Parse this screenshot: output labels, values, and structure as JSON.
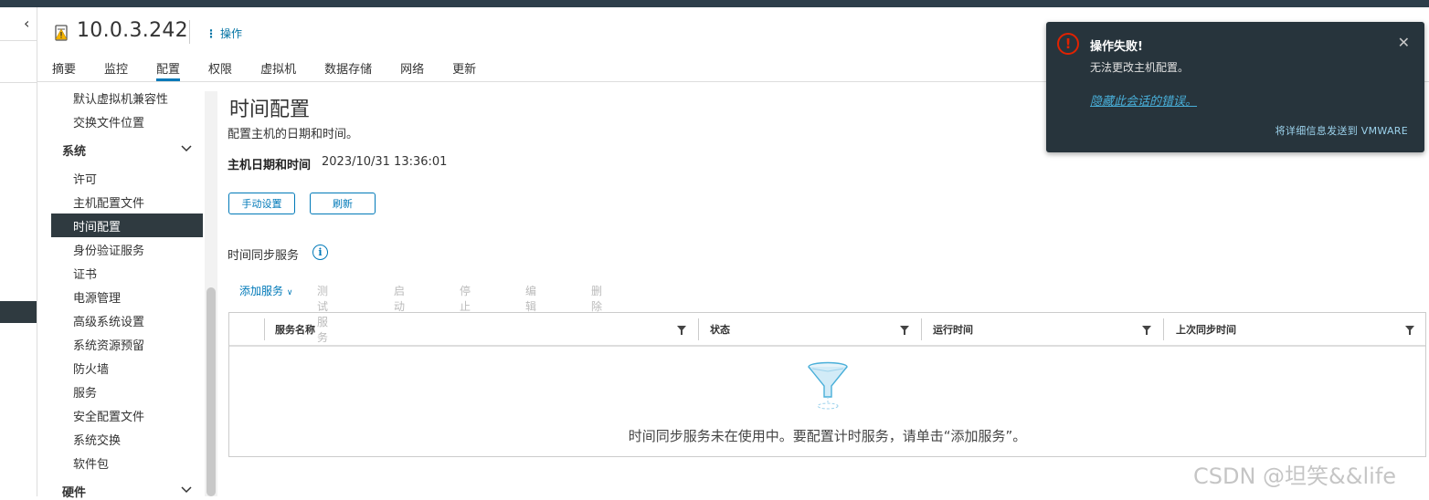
{
  "header": {
    "host": "10.0.3.242",
    "actions_label": "操作",
    "tabs": [
      "摘要",
      "监控",
      "配置",
      "权限",
      "虚拟机",
      "数据存储",
      "网络",
      "更新"
    ],
    "active_tab": "配置"
  },
  "config_nav": {
    "items_top": [
      "默认虚拟机兼容性",
      "交换文件位置"
    ],
    "group_system": "系统",
    "system_items": [
      "许可",
      "主机配置文件",
      "时间配置",
      "身份验证服务",
      "证书",
      "电源管理",
      "高级系统设置",
      "系统资源预留",
      "防火墙",
      "服务",
      "安全配置文件",
      "系统交换",
      "软件包"
    ],
    "selected": "时间配置",
    "group_hardware": "硬件"
  },
  "main": {
    "title": "时间配置",
    "description": "配置主机的日期和时间。",
    "datetime_label": "主机日期和时间",
    "datetime_value": "2023/10/31 13:36:01",
    "buttons": {
      "manual": "手动设置",
      "refresh": "刷新"
    },
    "sync_title": "时间同步服务",
    "toolbar": {
      "add": "添加服务",
      "test": "测试服务",
      "start": "启动",
      "stop": "停止",
      "edit": "编辑",
      "delete": "删除"
    },
    "columns": [
      "服务名称",
      "状态",
      "运行时间",
      "上次同步时间"
    ],
    "empty_message": "时间同步服务未在使用中。要配置计时服务，请单击“添加服务”。"
  },
  "toast": {
    "title": "操作失败!",
    "message": "无法更改主机配置。",
    "link": "隐藏此会话的错误。",
    "send": "将详细信息发送到 VMWARE"
  },
  "watermark": "CSDN @坦笑&&life",
  "colors": {
    "accent": "#0079b8",
    "nav_selected": "#2f3a40",
    "toast_bg": "#27343c",
    "error": "#e12200"
  }
}
